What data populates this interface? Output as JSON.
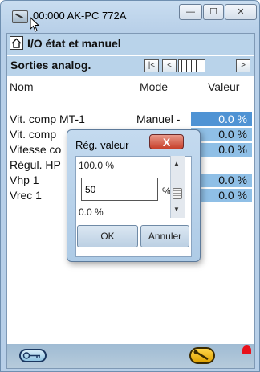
{
  "window": {
    "title": "00:000 AK-PC 772A",
    "minimize_symbol": "—",
    "maximize_symbol": "☐",
    "close_symbol": "✕"
  },
  "header": {
    "title": "I/O  état et manuel",
    "home_icon": "home-icon"
  },
  "section": {
    "title": "Sorties analog.",
    "nav": {
      "first": "|<",
      "prev": "<",
      "next": ">"
    }
  },
  "columns": {
    "name": "Nom",
    "mode": "Mode",
    "value": "Valeur"
  },
  "rows": [
    {
      "name": "Vit. comp MT-1",
      "mode": "Manuel -",
      "value": "0.0 %"
    },
    {
      "name": "Vit. comp",
      "mode": "",
      "value": "0.0 %"
    },
    {
      "name": "Vitesse co",
      "mode": "",
      "value": "0.0 %"
    },
    {
      "name": "Régul. HP",
      "mode": "",
      "value": ""
    },
    {
      "name": "Vhp 1",
      "mode": "",
      "value": "0.0 %"
    },
    {
      "name": "Vrec 1",
      "mode": "",
      "value": "0.0 %"
    }
  ],
  "dialog": {
    "title": "Rég. valeur",
    "close_symbol": "X",
    "max_label": "100.0 %",
    "min_label": "0.0 %",
    "input_value": "50",
    "unit": "%",
    "ok_label": "OK",
    "cancel_label": "Annuler"
  },
  "bottom": {
    "icons": [
      "key-icon",
      "wrench-icon",
      "alarm-icon"
    ]
  },
  "colors": {
    "header_bg": "#b9d3ea",
    "value_cell": "#8fbfe6",
    "value_cell_selected": "#4f93d4",
    "alarm": "#e8111b"
  }
}
